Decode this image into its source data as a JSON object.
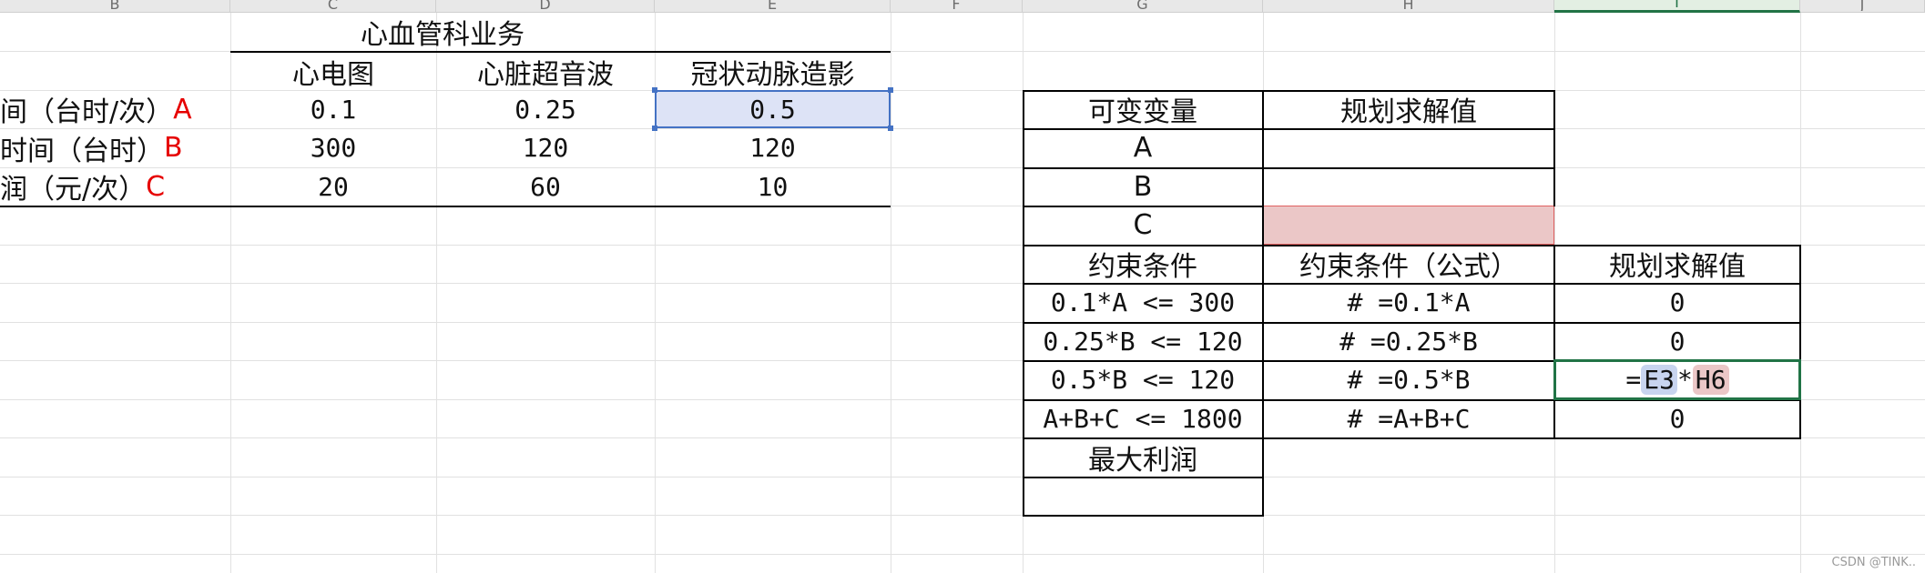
{
  "column_headers": [
    "B",
    "C",
    "D",
    "E",
    "F",
    "G",
    "H",
    "I",
    "J"
  ],
  "selected_column": "I",
  "left_table": {
    "group_header": "心血管科业务",
    "columns": [
      "心电图",
      "心脏超音波",
      "冠状动脉造影"
    ],
    "rows": [
      {
        "label": "间（台时/次）",
        "var": "A",
        "values": [
          "0.1",
          "0.25",
          "0.5"
        ]
      },
      {
        "label": "时间（台时）",
        "var": "B",
        "values": [
          "300",
          "120",
          "120"
        ]
      },
      {
        "label": "润（元/次）",
        "var": "C",
        "values": [
          "20",
          "60",
          "10"
        ]
      }
    ]
  },
  "variables_table": {
    "headers": [
      "可变变量",
      "规划求解值"
    ],
    "rows": [
      {
        "name": "A",
        "value": ""
      },
      {
        "name": "B",
        "value": ""
      },
      {
        "name": "C",
        "value": ""
      }
    ]
  },
  "constraints_table": {
    "headers": [
      "约束条件",
      "约束条件（公式）",
      "规划求解值"
    ],
    "rows": [
      {
        "condition": "0.1*A <= 300",
        "formula": "# =0.1*A",
        "value": "0"
      },
      {
        "condition": "0.25*B <= 120",
        "formula": "# =0.25*B",
        "value": "0"
      },
      {
        "condition": "0.5*B <= 120",
        "formula": "# =0.5*B",
        "value": ""
      },
      {
        "condition": "A+B+C <= 1800",
        "formula": "# =A+B+C",
        "value": "0"
      }
    ],
    "editing_formula": {
      "prefix": "=",
      "ref1": "E3",
      "op": "*",
      "ref2": "H6"
    }
  },
  "profit_table": {
    "header": "最大利润",
    "value": ""
  },
  "watermark": "CSDN @TINK..",
  "colors": {
    "accent_green": "#217346",
    "selection_blue": "#4472c4",
    "ref_red": "#ebc7c7",
    "label_red": "#e60000"
  }
}
